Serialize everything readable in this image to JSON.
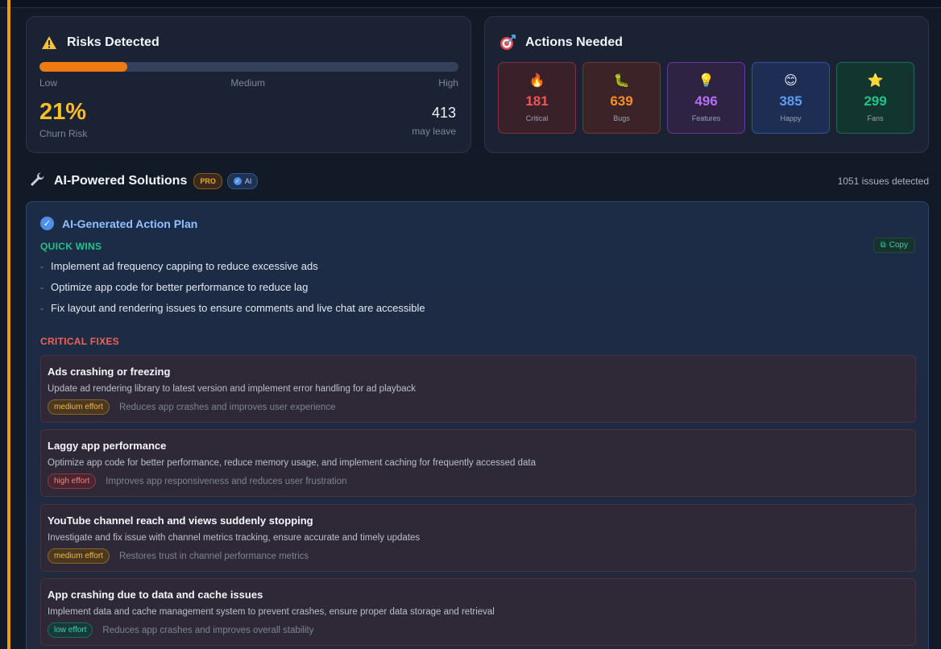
{
  "colors": {
    "accent": "#f29a18",
    "risk_fill": "#f07a12",
    "churn": "#fbbf24",
    "critical": "#f05656",
    "bugs": "#fb8c2a",
    "features": "#b46ef5",
    "happy": "#5d9df7",
    "fans": "#1fc48a"
  },
  "risks": {
    "title": "Risks Detected",
    "icon": "warning-icon",
    "level_percent": 21,
    "scale": [
      "Low",
      "Medium",
      "High"
    ],
    "churn_value": "21%",
    "churn_label": "Churn Risk",
    "leave_value": "413",
    "leave_label": "may leave"
  },
  "actions": {
    "title": "Actions Needed",
    "icon": "target-icon",
    "tiles": [
      {
        "icon": "fire-icon",
        "glyph": "🔥",
        "value": "181",
        "label": "Critical"
      },
      {
        "icon": "bug-icon",
        "glyph": "🐛",
        "value": "639",
        "label": "Bugs"
      },
      {
        "icon": "lightbulb-icon",
        "glyph": "💡",
        "value": "496",
        "label": "Features"
      },
      {
        "icon": "smile-icon",
        "glyph": "😊",
        "value": "385",
        "label": "Happy"
      },
      {
        "icon": "star-icon",
        "glyph": "⭐",
        "value": "299",
        "label": "Fans"
      }
    ]
  },
  "solutions": {
    "title": "AI-Powered Solutions",
    "icon": "wrench-icon",
    "badge_pro": "PRO",
    "badge_ai": "AI",
    "issues_count": "1051 issues detected"
  },
  "plan": {
    "title": "AI-Generated Action Plan",
    "quick_wins_title": "QUICK WINS",
    "copy_label": "Copy",
    "quick_wins": [
      "Implement ad frequency capping to reduce excessive ads",
      "Optimize app code for better performance to reduce lag",
      "Fix layout and rendering issues to ensure comments and live chat are accessible"
    ],
    "critical_title": "CRITICAL FIXES",
    "fixes": [
      {
        "title": "Ads crashing or freezing",
        "desc": "Update ad rendering library to latest version and implement error handling for ad playback",
        "effort": "medium effort",
        "impact": "Reduces app crashes and improves user experience"
      },
      {
        "title": "Laggy app performance",
        "desc": "Optimize app code for better performance, reduce memory usage, and implement caching for frequently accessed data",
        "effort": "high effort",
        "impact": "Improves app responsiveness and reduces user frustration"
      },
      {
        "title": "YouTube channel reach and views suddenly stopping",
        "desc": "Investigate and fix issue with channel metrics tracking, ensure accurate and timely updates",
        "effort": "medium effort",
        "impact": "Restores trust in channel performance metrics"
      },
      {
        "title": "App crashing due to data and cache issues",
        "desc": "Implement data and cache management system to prevent crashes, ensure proper data storage and retrieval",
        "effort": "low effort",
        "impact": "Reduces app crashes and improves overall stability"
      }
    ]
  }
}
